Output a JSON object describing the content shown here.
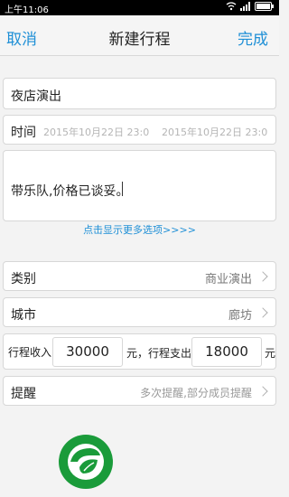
{
  "status": {
    "time": "上午11:06"
  },
  "nav": {
    "cancel": "取消",
    "title": "新建行程",
    "done": "完成"
  },
  "form": {
    "name": "夜店演出",
    "time_label": "时间",
    "start_time": "2015年10月22日  23:0",
    "end_time": "2015年10月22日  23:0",
    "notes": "带乐队,价格已谈妥。",
    "more_options": "点击显示更多选项>>>>",
    "category_label": "类别",
    "category_value": "商业演出",
    "city_label": "城市",
    "city_value": "廊坊",
    "income_label": "行程收入",
    "income_value": "30000",
    "yuan1": "元，行程支出",
    "expense_value": "18000",
    "yuan2": "元",
    "reminder_label": "提醒",
    "reminder_value": "多次提醒,部分成员提醒"
  },
  "colors": {
    "accent": "#1e8fd6",
    "logo_green": "#1a9b3a"
  }
}
